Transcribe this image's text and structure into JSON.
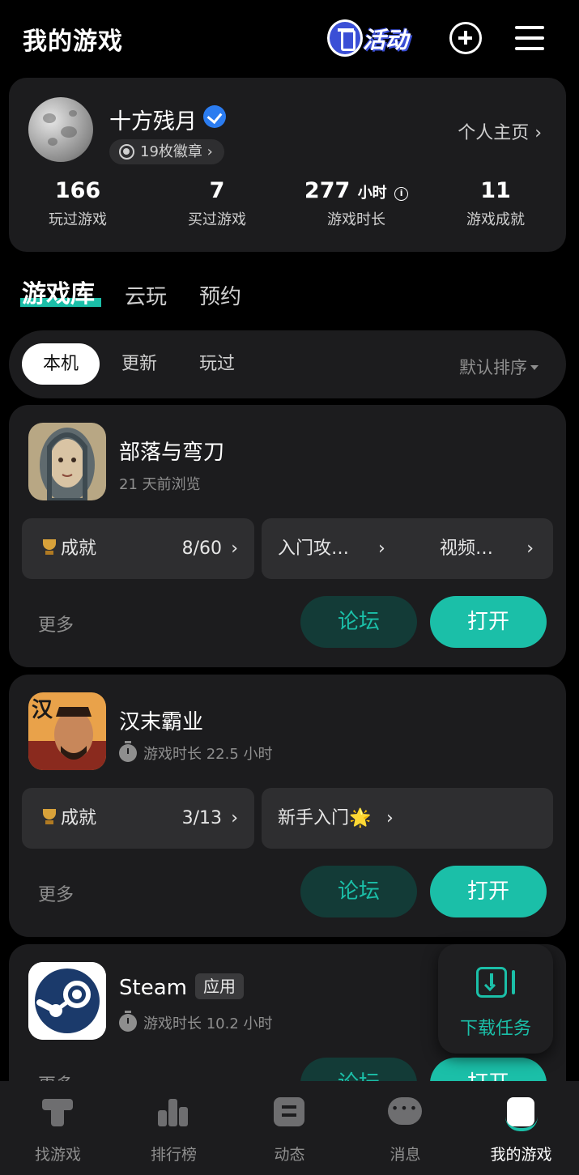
{
  "header": {
    "title": "我的游戏",
    "activity_label": "活动",
    "icons": [
      "gift-icon",
      "plus-circle-icon",
      "menu-icon"
    ]
  },
  "profile": {
    "name": "十方残月",
    "badges": "19枚徽章 ›",
    "homepage_link": "个人主页 ›",
    "stats": [
      {
        "value": "166",
        "label": "玩过游戏"
      },
      {
        "value": "7",
        "label": "买过游戏"
      },
      {
        "value": "277",
        "unit": "小时",
        "label": "游戏时长"
      },
      {
        "value": "11",
        "label": "游戏成就"
      }
    ]
  },
  "tabs": [
    {
      "label": "游戏库",
      "active": true
    },
    {
      "label": "云玩",
      "active": false
    },
    {
      "label": "预约",
      "active": false
    }
  ],
  "filters": {
    "chips": [
      "本机",
      "更新",
      "玩过"
    ],
    "active": "本机",
    "sort": "默认排序"
  },
  "games": [
    {
      "name": "部落与弯刀",
      "sub": "21 天前浏览",
      "achievement_label": "成就",
      "achievement_progress": "8/60",
      "guide_1": "入门攻…",
      "guide_2": "视频…",
      "more": "更多",
      "forum": "论坛",
      "open": "打开"
    },
    {
      "name": "汉末霸业",
      "sub": "游戏时长 22.5 小时",
      "achievement_label": "成就",
      "achievement_progress": "3/13",
      "guide_1": "新手入门🌟",
      "more": "更多",
      "forum": "论坛",
      "open": "打开"
    },
    {
      "name": "Steam",
      "tag": "应用",
      "sub": "游戏时长 10.2 小时",
      "more": "更多",
      "forum": "论坛",
      "open": "打开"
    }
  ],
  "download_task": "下载任务",
  "bottom_nav": [
    {
      "label": "找游戏",
      "icon": "find-game-icon"
    },
    {
      "label": "排行榜",
      "icon": "ranking-icon"
    },
    {
      "label": "动态",
      "icon": "feed-icon"
    },
    {
      "label": "消息",
      "icon": "message-icon"
    },
    {
      "label": "我的游戏",
      "icon": "my-games-icon",
      "active": true
    }
  ],
  "colors": {
    "accent": "#1bbfa8",
    "background": "#000000",
    "card": "#1c1c1e",
    "tile": "#2e2e30"
  }
}
